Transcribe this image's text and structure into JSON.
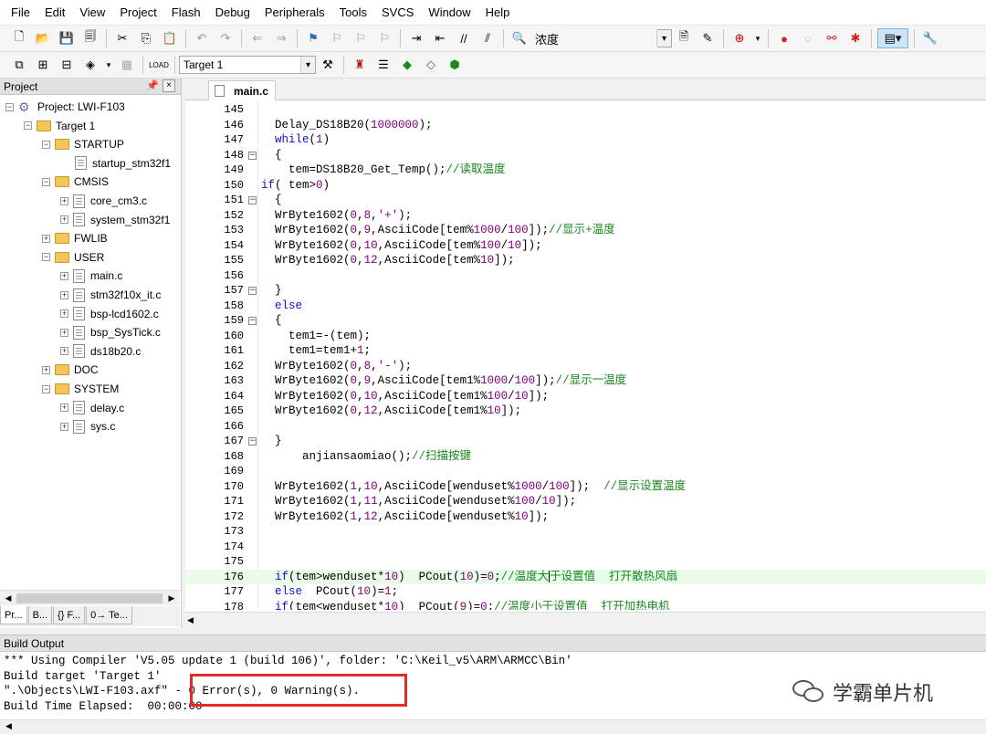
{
  "menu": [
    "File",
    "Edit",
    "View",
    "Project",
    "Flash",
    "Debug",
    "Peripherals",
    "Tools",
    "SVCS",
    "Window",
    "Help"
  ],
  "toolbar": {
    "find_text": "浓度",
    "target": "Target 1"
  },
  "project_panel": {
    "title": "Project",
    "pin": "ᵖ",
    "close": "×",
    "tabs": [
      "Pr...",
      "B...",
      "{} F...",
      "0→ Te..."
    ]
  },
  "tree": [
    {
      "label": "Project: LWI-F103",
      "depth": 0,
      "type": "project",
      "exp": "−"
    },
    {
      "label": "Target 1",
      "depth": 1,
      "type": "target",
      "exp": "−"
    },
    {
      "label": "STARTUP",
      "depth": 2,
      "type": "folder",
      "exp": "−"
    },
    {
      "label": "startup_stm32f1",
      "depth": 3,
      "type": "file",
      "exp": ""
    },
    {
      "label": "CMSIS",
      "depth": 2,
      "type": "folder",
      "exp": "−"
    },
    {
      "label": "core_cm3.c",
      "depth": 3,
      "type": "file",
      "exp": "+"
    },
    {
      "label": "system_stm32f1",
      "depth": 3,
      "type": "file",
      "exp": "+"
    },
    {
      "label": "FWLIB",
      "depth": 2,
      "type": "folder",
      "exp": "+"
    },
    {
      "label": "USER",
      "depth": 2,
      "type": "folder",
      "exp": "−"
    },
    {
      "label": "main.c",
      "depth": 3,
      "type": "file",
      "exp": "+"
    },
    {
      "label": "stm32f10x_it.c",
      "depth": 3,
      "type": "file",
      "exp": "+"
    },
    {
      "label": "bsp-lcd1602.c",
      "depth": 3,
      "type": "file",
      "exp": "+"
    },
    {
      "label": "bsp_SysTick.c",
      "depth": 3,
      "type": "file",
      "exp": "+"
    },
    {
      "label": "ds18b20.c",
      "depth": 3,
      "type": "file",
      "exp": "+"
    },
    {
      "label": "DOC",
      "depth": 2,
      "type": "folder",
      "exp": "+"
    },
    {
      "label": "SYSTEM",
      "depth": 2,
      "type": "folder",
      "exp": "−"
    },
    {
      "label": "delay.c",
      "depth": 3,
      "type": "file",
      "exp": "+"
    },
    {
      "label": "sys.c",
      "depth": 3,
      "type": "file",
      "exp": "+"
    }
  ],
  "editor": {
    "tab": "main.c",
    "lines": [
      {
        "n": "145",
        "fold": "",
        "segs": [
          {
            "t": "",
            "c": ""
          }
        ]
      },
      {
        "n": "146",
        "fold": "",
        "segs": [
          {
            "t": "  Delay_DS18B20(",
            "c": ""
          },
          {
            "t": "1000000",
            "c": "num"
          },
          {
            "t": ");",
            "c": ""
          }
        ]
      },
      {
        "n": "147",
        "fold": "",
        "segs": [
          {
            "t": "  ",
            "c": ""
          },
          {
            "t": "while",
            "c": "kw"
          },
          {
            "t": "(",
            "c": ""
          },
          {
            "t": "1",
            "c": "num"
          },
          {
            "t": ")",
            "c": ""
          }
        ]
      },
      {
        "n": "148",
        "fold": "−",
        "segs": [
          {
            "t": "  {",
            "c": ""
          }
        ]
      },
      {
        "n": "149",
        "fold": "",
        "segs": [
          {
            "t": "    tem=DS18B20_Get_Temp();",
            "c": ""
          },
          {
            "t": "//读取温度",
            "c": "cm"
          }
        ]
      },
      {
        "n": "150",
        "fold": "",
        "segs": [
          {
            "t": "if",
            "c": "kw"
          },
          {
            "t": "( tem>",
            "c": ""
          },
          {
            "t": "0",
            "c": "num"
          },
          {
            "t": ")",
            "c": ""
          }
        ]
      },
      {
        "n": "151",
        "fold": "−",
        "segs": [
          {
            "t": "  {",
            "c": ""
          }
        ]
      },
      {
        "n": "152",
        "fold": "",
        "segs": [
          {
            "t": "  WrByte1602(",
            "c": ""
          },
          {
            "t": "0",
            "c": "num"
          },
          {
            "t": ",",
            "c": ""
          },
          {
            "t": "8",
            "c": "num"
          },
          {
            "t": ",",
            "c": ""
          },
          {
            "t": "'+'",
            "c": "str"
          },
          {
            "t": ");",
            "c": ""
          }
        ]
      },
      {
        "n": "153",
        "fold": "",
        "segs": [
          {
            "t": "  WrByte1602(",
            "c": ""
          },
          {
            "t": "0",
            "c": "num"
          },
          {
            "t": ",",
            "c": ""
          },
          {
            "t": "9",
            "c": "num"
          },
          {
            "t": ",AsciiCode[tem%",
            "c": ""
          },
          {
            "t": "1000",
            "c": "num"
          },
          {
            "t": "/",
            "c": ""
          },
          {
            "t": "100",
            "c": "num"
          },
          {
            "t": "]);",
            "c": ""
          },
          {
            "t": "//显示+温度",
            "c": "cm"
          }
        ]
      },
      {
        "n": "154",
        "fold": "",
        "segs": [
          {
            "t": "  WrByte1602(",
            "c": ""
          },
          {
            "t": "0",
            "c": "num"
          },
          {
            "t": ",",
            "c": ""
          },
          {
            "t": "10",
            "c": "num"
          },
          {
            "t": ",AsciiCode[tem%",
            "c": ""
          },
          {
            "t": "100",
            "c": "num"
          },
          {
            "t": "/",
            "c": ""
          },
          {
            "t": "10",
            "c": "num"
          },
          {
            "t": "]);",
            "c": ""
          }
        ]
      },
      {
        "n": "155",
        "fold": "",
        "segs": [
          {
            "t": "  WrByte1602(",
            "c": ""
          },
          {
            "t": "0",
            "c": "num"
          },
          {
            "t": ",",
            "c": ""
          },
          {
            "t": "12",
            "c": "num"
          },
          {
            "t": ",AsciiCode[tem%",
            "c": ""
          },
          {
            "t": "10",
            "c": "num"
          },
          {
            "t": "]);",
            "c": ""
          }
        ]
      },
      {
        "n": "156",
        "fold": "",
        "segs": [
          {
            "t": "",
            "c": ""
          }
        ]
      },
      {
        "n": "157",
        "fold": "−",
        "segs": [
          {
            "t": "  }",
            "c": ""
          }
        ]
      },
      {
        "n": "158",
        "fold": "",
        "segs": [
          {
            "t": "  ",
            "c": ""
          },
          {
            "t": "else",
            "c": "kw"
          }
        ]
      },
      {
        "n": "159",
        "fold": "−",
        "segs": [
          {
            "t": "  {",
            "c": ""
          }
        ]
      },
      {
        "n": "160",
        "fold": "",
        "segs": [
          {
            "t": "    tem1=-(tem);",
            "c": ""
          }
        ]
      },
      {
        "n": "161",
        "fold": "",
        "segs": [
          {
            "t": "    tem1=tem1+",
            "c": ""
          },
          {
            "t": "1",
            "c": "num"
          },
          {
            "t": ";",
            "c": ""
          }
        ]
      },
      {
        "n": "162",
        "fold": "",
        "segs": [
          {
            "t": "  WrByte1602(",
            "c": ""
          },
          {
            "t": "0",
            "c": "num"
          },
          {
            "t": ",",
            "c": ""
          },
          {
            "t": "8",
            "c": "num"
          },
          {
            "t": ",",
            "c": ""
          },
          {
            "t": "'-'",
            "c": "str"
          },
          {
            "t": ");",
            "c": ""
          }
        ]
      },
      {
        "n": "163",
        "fold": "",
        "segs": [
          {
            "t": "  WrByte1602(",
            "c": ""
          },
          {
            "t": "0",
            "c": "num"
          },
          {
            "t": ",",
            "c": ""
          },
          {
            "t": "9",
            "c": "num"
          },
          {
            "t": ",AsciiCode[tem1%",
            "c": ""
          },
          {
            "t": "1000",
            "c": "num"
          },
          {
            "t": "/",
            "c": ""
          },
          {
            "t": "100",
            "c": "num"
          },
          {
            "t": "]);",
            "c": ""
          },
          {
            "t": "//显示一温度",
            "c": "cm"
          }
        ]
      },
      {
        "n": "164",
        "fold": "",
        "segs": [
          {
            "t": "  WrByte1602(",
            "c": ""
          },
          {
            "t": "0",
            "c": "num"
          },
          {
            "t": ",",
            "c": ""
          },
          {
            "t": "10",
            "c": "num"
          },
          {
            "t": ",AsciiCode[tem1%",
            "c": ""
          },
          {
            "t": "100",
            "c": "num"
          },
          {
            "t": "/",
            "c": ""
          },
          {
            "t": "10",
            "c": "num"
          },
          {
            "t": "]);",
            "c": ""
          }
        ]
      },
      {
        "n": "165",
        "fold": "",
        "segs": [
          {
            "t": "  WrByte1602(",
            "c": ""
          },
          {
            "t": "0",
            "c": "num"
          },
          {
            "t": ",",
            "c": ""
          },
          {
            "t": "12",
            "c": "num"
          },
          {
            "t": ",AsciiCode[tem1%",
            "c": ""
          },
          {
            "t": "10",
            "c": "num"
          },
          {
            "t": "]);",
            "c": ""
          }
        ]
      },
      {
        "n": "166",
        "fold": "",
        "segs": [
          {
            "t": "",
            "c": ""
          }
        ]
      },
      {
        "n": "167",
        "fold": "−",
        "segs": [
          {
            "t": "  }",
            "c": ""
          }
        ]
      },
      {
        "n": "168",
        "fold": "",
        "segs": [
          {
            "t": "      anjiansaomiao();",
            "c": ""
          },
          {
            "t": "//扫描按键",
            "c": "cm"
          }
        ]
      },
      {
        "n": "169",
        "fold": "",
        "segs": [
          {
            "t": "",
            "c": ""
          }
        ]
      },
      {
        "n": "170",
        "fold": "",
        "segs": [
          {
            "t": "  WrByte1602(",
            "c": ""
          },
          {
            "t": "1",
            "c": "num"
          },
          {
            "t": ",",
            "c": ""
          },
          {
            "t": "10",
            "c": "num"
          },
          {
            "t": ",AsciiCode[wenduset%",
            "c": ""
          },
          {
            "t": "1000",
            "c": "num"
          },
          {
            "t": "/",
            "c": ""
          },
          {
            "t": "100",
            "c": "num"
          },
          {
            "t": "]);  ",
            "c": ""
          },
          {
            "t": "//显示设置温度",
            "c": "cm"
          }
        ]
      },
      {
        "n": "171",
        "fold": "",
        "segs": [
          {
            "t": "  WrByte1602(",
            "c": ""
          },
          {
            "t": "1",
            "c": "num"
          },
          {
            "t": ",",
            "c": ""
          },
          {
            "t": "11",
            "c": "num"
          },
          {
            "t": ",AsciiCode[wenduset%",
            "c": ""
          },
          {
            "t": "100",
            "c": "num"
          },
          {
            "t": "/",
            "c": ""
          },
          {
            "t": "10",
            "c": "num"
          },
          {
            "t": "]);",
            "c": ""
          }
        ]
      },
      {
        "n": "172",
        "fold": "",
        "segs": [
          {
            "t": "  WrByte1602(",
            "c": ""
          },
          {
            "t": "1",
            "c": "num"
          },
          {
            "t": ",",
            "c": ""
          },
          {
            "t": "12",
            "c": "num"
          },
          {
            "t": ",AsciiCode[wenduset%",
            "c": ""
          },
          {
            "t": "10",
            "c": "num"
          },
          {
            "t": "]);",
            "c": ""
          }
        ]
      },
      {
        "n": "173",
        "fold": "",
        "segs": [
          {
            "t": "",
            "c": ""
          }
        ]
      },
      {
        "n": "174",
        "fold": "",
        "segs": [
          {
            "t": "",
            "c": ""
          }
        ]
      },
      {
        "n": "175",
        "fold": "",
        "segs": [
          {
            "t": "",
            "c": ""
          }
        ]
      },
      {
        "n": "176",
        "fold": "",
        "hl": true,
        "segs": [
          {
            "t": "  ",
            "c": ""
          },
          {
            "t": "if",
            "c": "kw"
          },
          {
            "t": "(tem>wenduset*",
            "c": ""
          },
          {
            "t": "10",
            "c": "num"
          },
          {
            "t": ")  PCout(",
            "c": ""
          },
          {
            "t": "10",
            "c": "num"
          },
          {
            "t": ")=",
            "c": ""
          },
          {
            "t": "0",
            "c": "num"
          },
          {
            "t": ";",
            "c": ""
          },
          {
            "t": "//温度大",
            "c": "cm"
          },
          {
            "t": "|",
            "c": "cursor"
          },
          {
            "t": "于设置值  打开散热风扇",
            "c": "cm"
          }
        ]
      },
      {
        "n": "177",
        "fold": "",
        "segs": [
          {
            "t": "  ",
            "c": ""
          },
          {
            "t": "else",
            "c": "kw"
          },
          {
            "t": "  PCout(",
            "c": ""
          },
          {
            "t": "10",
            "c": "num"
          },
          {
            "t": ")=",
            "c": ""
          },
          {
            "t": "1",
            "c": "num"
          },
          {
            "t": ";",
            "c": ""
          }
        ]
      },
      {
        "n": "178",
        "fold": "",
        "segs": [
          {
            "t": "  ",
            "c": ""
          },
          {
            "t": "if",
            "c": "kw"
          },
          {
            "t": "(tem<wenduset*",
            "c": ""
          },
          {
            "t": "10",
            "c": "num"
          },
          {
            "t": ")  PCout(",
            "c": ""
          },
          {
            "t": "9",
            "c": "num"
          },
          {
            "t": ")=",
            "c": ""
          },
          {
            "t": "0",
            "c": "num"
          },
          {
            "t": ";",
            "c": ""
          },
          {
            "t": "//温度小于设置值  打开加热电机",
            "c": "cm"
          }
        ]
      }
    ]
  },
  "build_output": {
    "title": "Build Output",
    "lines": [
      "*** Using Compiler 'V5.05 update 1 (build 106)', folder: 'C:\\Keil_v5\\ARM\\ARMCC\\Bin'",
      "Build target 'Target 1'",
      "\".\\Objects\\LWI-F103.axf\" - 0 Error(s), 0 Warning(s).",
      "Build Time Elapsed:  00:00:00"
    ],
    "watermark": "学霸单片机"
  }
}
